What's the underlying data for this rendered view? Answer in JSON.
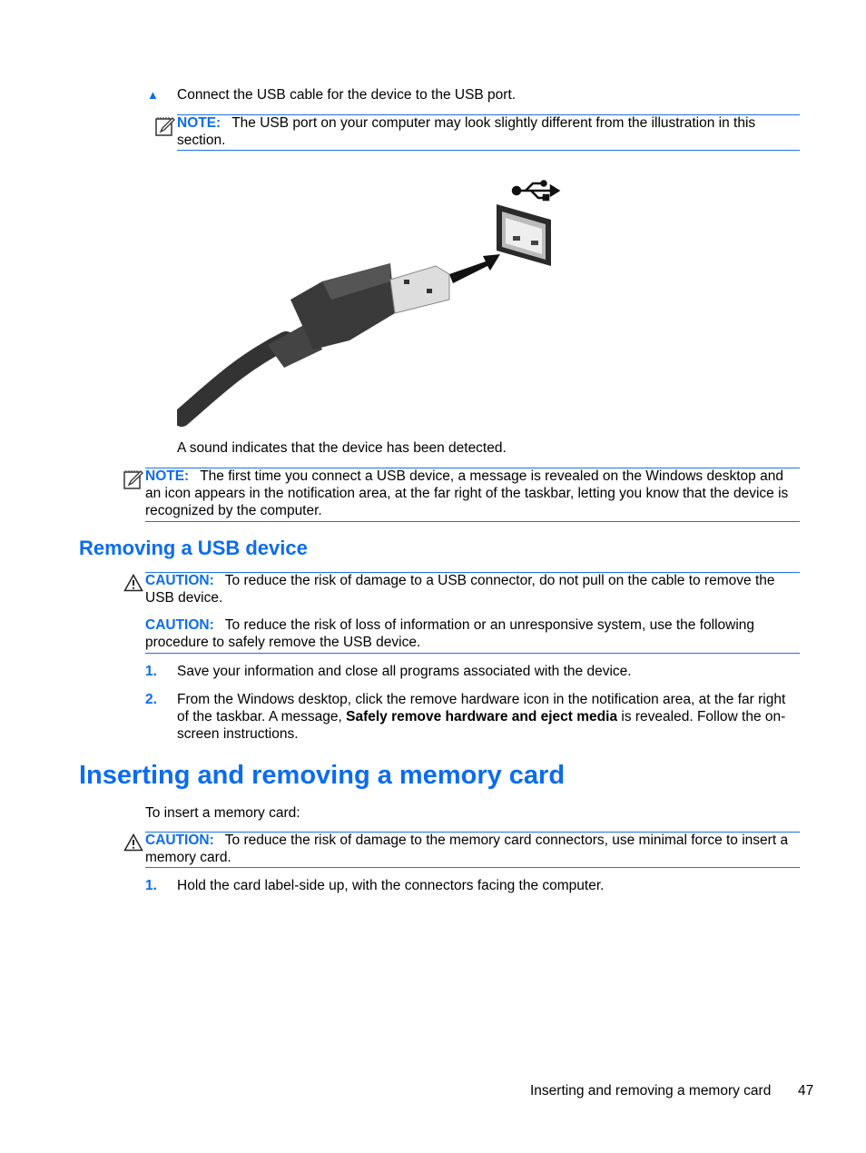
{
  "step_connect": {
    "bullet": "▲",
    "text": "Connect the USB cable for the device to the USB port."
  },
  "note1": {
    "label": "NOTE:",
    "text": "The USB port on your computer may look slightly different from the illustration in this section."
  },
  "illustration": {
    "alt": "USB cable plug being inserted into USB port with USB symbol"
  },
  "detected_text": "A sound indicates that the device has been detected.",
  "note2": {
    "label": "NOTE:",
    "text": "The first time you connect a USB device, a message is revealed on the Windows desktop and an icon appears in the notification area, at the far right of the taskbar, letting you know that the device is recognized by the computer."
  },
  "section_removing": {
    "title": "Removing a USB device",
    "caution1": {
      "label": "CAUTION:",
      "text": "To reduce the risk of damage to a USB connector, do not pull on the cable to remove the USB device."
    },
    "caution2": {
      "label": "CAUTION:",
      "text": "To reduce the risk of loss of information or an unresponsive system, use the following procedure to safely remove the USB device."
    },
    "steps": [
      {
        "num": "1.",
        "text": "Save your information and close all programs associated with the device."
      },
      {
        "num": "2.",
        "text_before": "From the Windows desktop, click the remove hardware icon in the notification area, at the far right of the taskbar. A message, ",
        "text_bold": "Safely remove hardware and eject media",
        "text_after": " is revealed. Follow the on-screen instructions."
      }
    ]
  },
  "section_memory": {
    "title": "Inserting and removing a memory card",
    "intro": "To insert a memory card:",
    "caution": {
      "label": "CAUTION:",
      "text": "To reduce the risk of damage to the memory card connectors, use minimal force to insert a memory card."
    },
    "steps": [
      {
        "num": "1.",
        "text": "Hold the card label-side up, with the connectors facing the computer."
      }
    ]
  },
  "footer": {
    "section": "Inserting and removing a memory card",
    "page": "47"
  }
}
